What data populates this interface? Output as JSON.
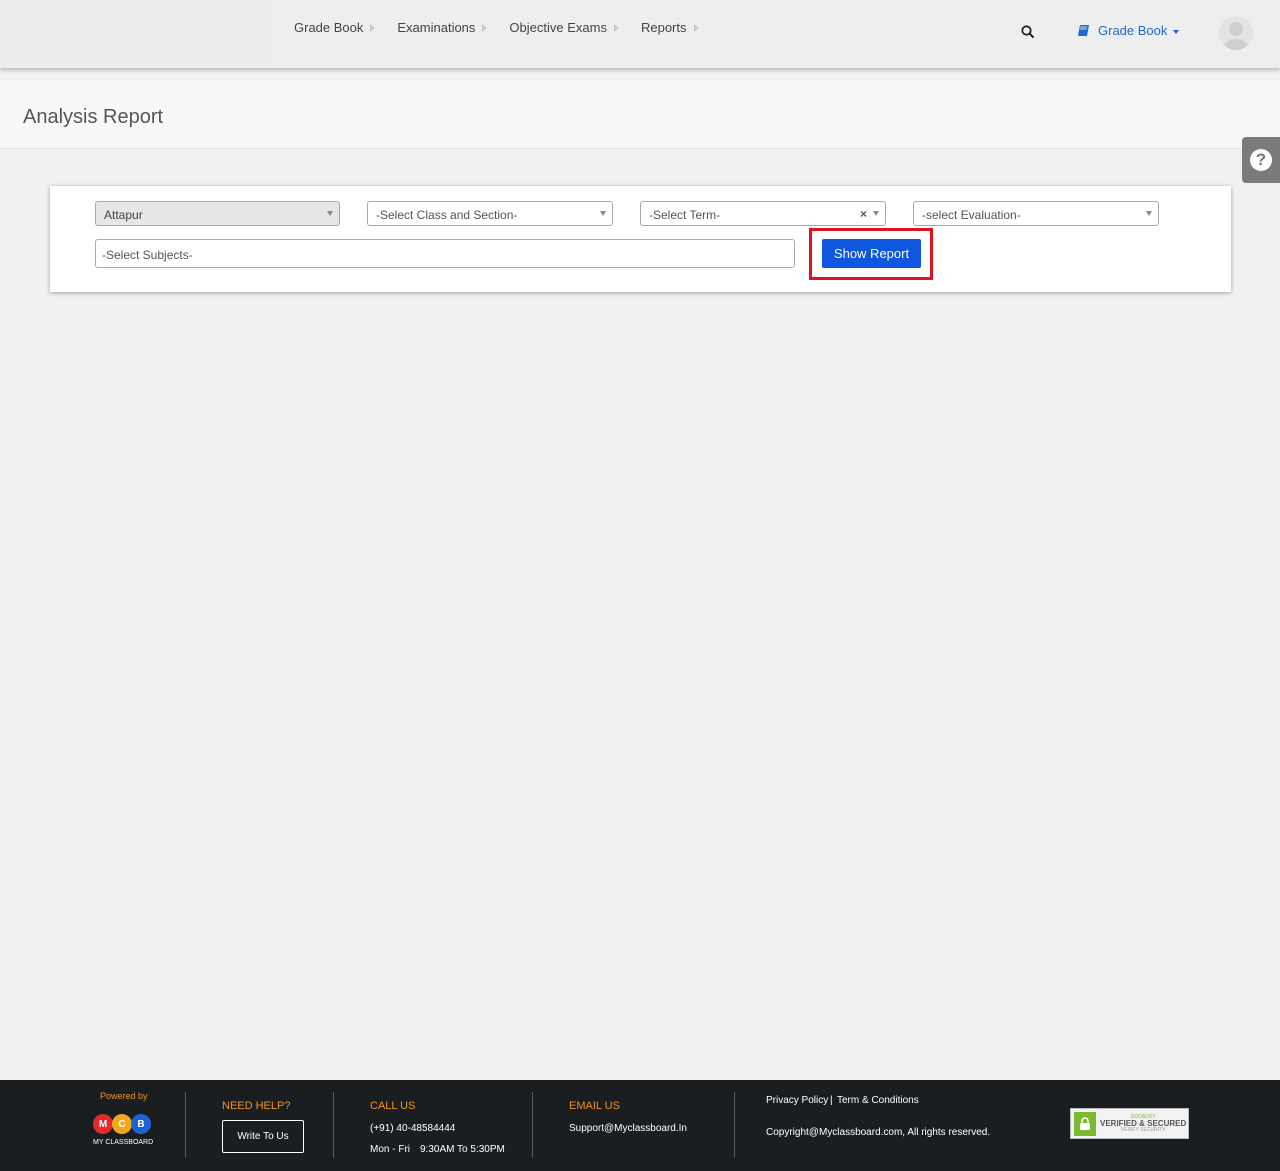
{
  "nav": {
    "items": [
      {
        "label": "Grade Book"
      },
      {
        "label": "Examinations"
      },
      {
        "label": "Objective Exams"
      },
      {
        "label": "Reports"
      }
    ],
    "module_label": "Grade Book"
  },
  "page": {
    "title": "Analysis Report"
  },
  "filters": {
    "branch": "Attapur",
    "class_section": "-Select Class and Section-",
    "term": "-Select Term-",
    "term_clear": "×",
    "evaluation": "-select Evaluation-",
    "subjects_placeholder": "-Select Subjects-",
    "show_report_label": "Show Report"
  },
  "footer": {
    "powered_by": "Powered by",
    "logo_letters": [
      "M",
      "C",
      "B"
    ],
    "logo_name": "MY CLASSBOARD",
    "need_help": "NEED HELP?",
    "write_to_us": "Write To Us",
    "call_us": "CALL US",
    "phone": "(+91) 40-48584444",
    "hours_days": "Mon - Fri",
    "hours_time": "9:30AM To 5:30PM",
    "email_us": "EMAIL US",
    "email": "Support@Myclassboard.In",
    "privacy": "Privacy Policy",
    "separator": "|",
    "terms": "Term & Conditions",
    "copyright": "Copyright@Myclassboard.com, All rights reserved.",
    "badge_line1": "GODADDY",
    "badge_line2": "VERIFIED & SECURED",
    "badge_line3": "VERIFY SECURITY"
  },
  "colors": {
    "accent_blue": "#1057e0",
    "link_blue": "#1e6ad1",
    "highlight_red": "#e0141e",
    "footer_orange": "#f0921e",
    "footer_bg": "#1b1e21"
  },
  "icons": {
    "search": "search-icon",
    "book": "book-icon",
    "help": "help-icon",
    "avatar": "user-avatar-icon",
    "lock": "lock-icon"
  }
}
